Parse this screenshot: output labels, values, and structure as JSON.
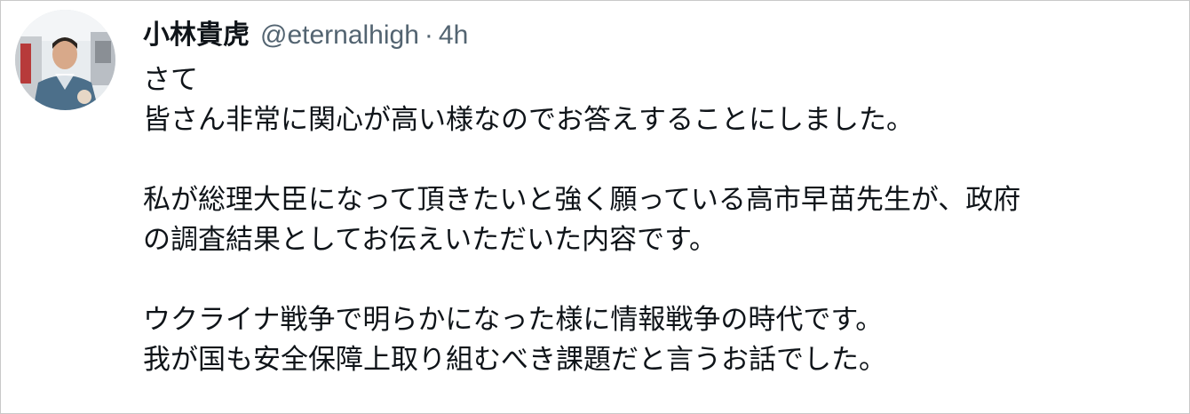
{
  "tweet": {
    "author_name": "小林貴虎",
    "handle": "@eternalhigh",
    "separator": "·",
    "time": "4h",
    "avatar_icon": "profile-photo",
    "lines": [
      "さて",
      "皆さん非常に関心が高い様なのでお答えすることにしました。",
      "",
      "私が総理大臣になって頂きたいと強く願っている高市早苗先生が、政府",
      "の調査結果としてお伝えいただいた内容です。",
      "",
      "ウクライナ戦争で明らかになった様に情報戦争の時代です。",
      "我が国も安全保障上取り組むべき課題だと言うお話でした。"
    ]
  }
}
